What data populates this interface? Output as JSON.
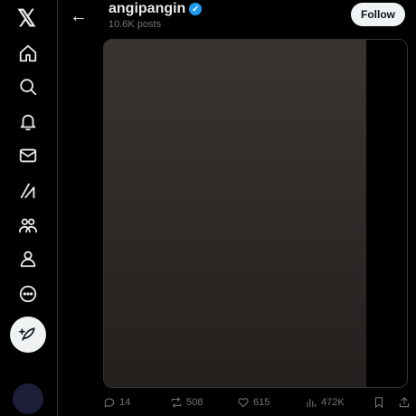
{
  "sidebar": {
    "logo": "𝕏",
    "items": [
      {
        "icon": "home-icon"
      },
      {
        "icon": "search-icon"
      },
      {
        "icon": "bell-icon"
      },
      {
        "icon": "mail-icon"
      },
      {
        "icon": "grok-icon"
      },
      {
        "icon": "communities-icon"
      },
      {
        "icon": "profile-icon"
      },
      {
        "icon": "more-icon"
      }
    ],
    "compose_icon": "feather-plus-icon"
  },
  "header": {
    "back": "←",
    "name": "angipangin",
    "verified": "✓",
    "posts": "10.6K posts",
    "follow": "Follow"
  },
  "actions": {
    "replies": "14",
    "reposts": "508",
    "likes": "615",
    "views": "472K"
  },
  "colors": {
    "accent": "#1d9bf0",
    "background": "#000000",
    "muted": "#71767b"
  }
}
